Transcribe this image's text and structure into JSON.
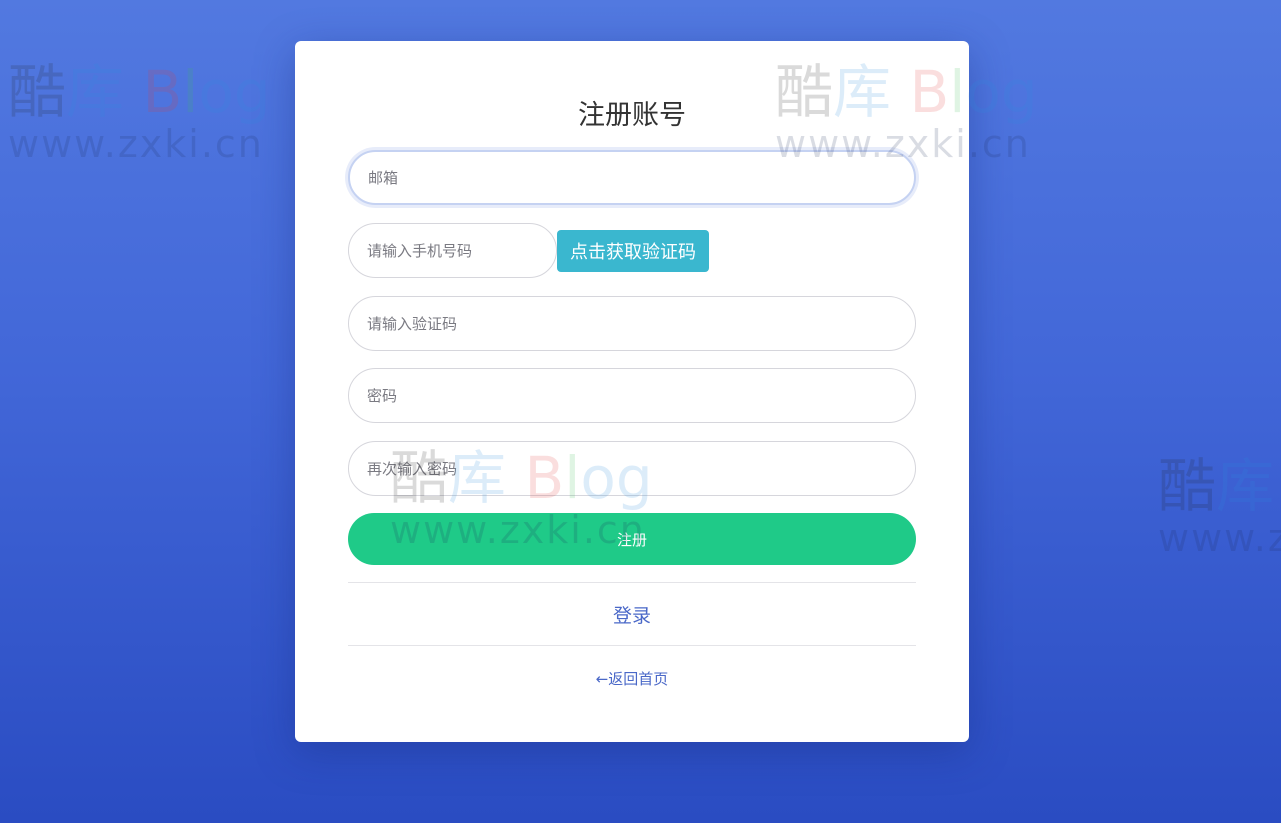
{
  "watermark": {
    "logo_char1": "酷",
    "logo_char2": "库",
    "logo_b1": "B",
    "logo_b2": "l",
    "logo_b3": "og",
    "url": "www.zxki.cn"
  },
  "form": {
    "title": "注册账号",
    "email_placeholder": "邮箱",
    "phone_placeholder": "请输入手机号码",
    "get_code_label": "点击获取验证码",
    "code_placeholder": "请输入验证码",
    "password_placeholder": "密码",
    "confirm_password_placeholder": "再次输入密码",
    "submit_label": "注册",
    "login_link": "登录",
    "home_link": "←返回首页"
  },
  "colors": {
    "background_top": "#5279e0",
    "background_bottom": "#2a4cc2",
    "code_button": "#3ab7cf",
    "submit_button": "#1fca88",
    "link": "#4a68c8"
  }
}
